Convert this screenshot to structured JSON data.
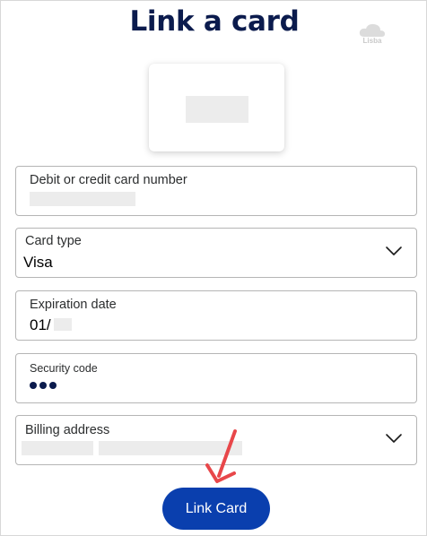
{
  "page": {
    "title": "Link a card",
    "watermark": "Lisba"
  },
  "fields": {
    "card_number": {
      "label": "Debit or credit card number",
      "value": ""
    },
    "card_type": {
      "label": "Card type",
      "value": "Visa"
    },
    "expiration": {
      "label": "Expiration date",
      "value": "01/"
    },
    "security_code": {
      "label": "Security code"
    },
    "billing_address": {
      "label": "Billing address",
      "value": ""
    }
  },
  "actions": {
    "submit_label": "Link Card"
  },
  "icons": {
    "card_type_toggle": "chevron-down-icon",
    "billing_toggle": "chevron-down-icon",
    "annotation": "arrow-icon"
  },
  "colors": {
    "title": "#0b1b4d",
    "button": "#0a3fae",
    "arrow": "#e8474a",
    "dot": "#0b1b4d"
  }
}
